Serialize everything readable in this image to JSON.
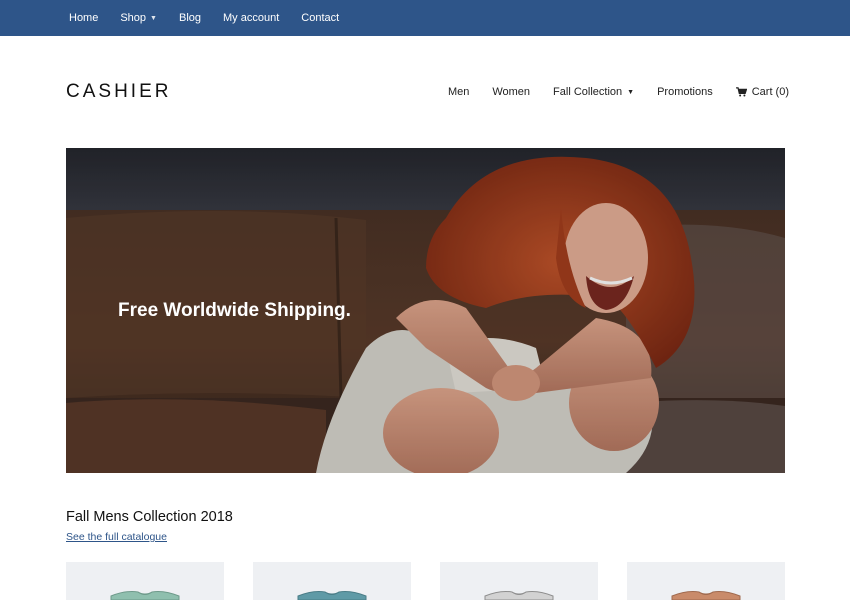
{
  "topbar": {
    "items": [
      {
        "label": "Home",
        "has_dropdown": false
      },
      {
        "label": "Shop",
        "has_dropdown": true
      },
      {
        "label": "Blog",
        "has_dropdown": false
      },
      {
        "label": "My account",
        "has_dropdown": false
      },
      {
        "label": "Contact",
        "has_dropdown": false
      }
    ],
    "background": "#2e5589"
  },
  "header": {
    "logo": "CASHIER",
    "nav": [
      {
        "label": "Men"
      },
      {
        "label": "Women"
      },
      {
        "label": "Fall Collection",
        "has_dropdown": true
      },
      {
        "label": "Promotions"
      }
    ],
    "cart_label": "Cart (0)",
    "cart_icon": "shopping-cart-icon"
  },
  "hero": {
    "headline": "Free Worldwide Shipping."
  },
  "collection": {
    "title": "Fall Mens Collection 2018",
    "link": "See the full catalogue",
    "products": [
      {
        "shirt_color": "#8fbfae"
      },
      {
        "shirt_color": "#5f9aa6"
      },
      {
        "shirt_color": "#b9b9b9"
      },
      {
        "shirt_color": "#c98b6a"
      }
    ]
  },
  "colors": {
    "accent": "#2e5589",
    "link": "#2e5589"
  }
}
